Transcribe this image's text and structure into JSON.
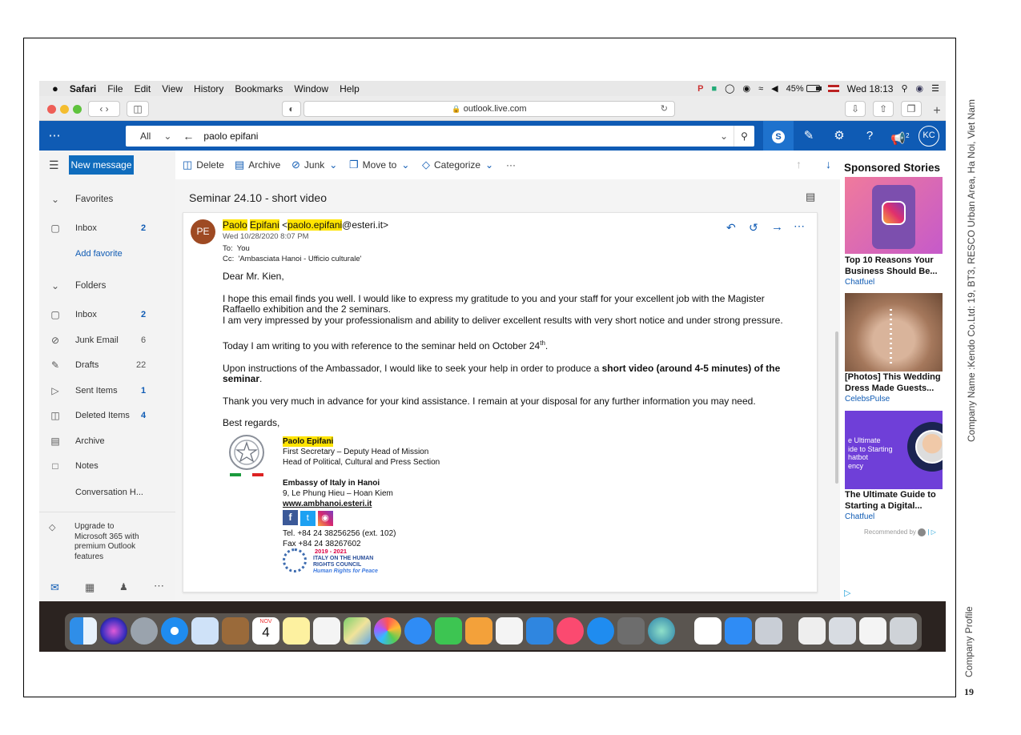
{
  "page": {
    "side_company": "Company Name  :Kendo Co.Ltd:  19, BT3, RESCO Urban Area, Ha Noi, Viet Nam",
    "side_profile": "Company Profile",
    "page_number": "19"
  },
  "mac_menu": {
    "app": "Safari",
    "items": [
      "File",
      "Edit",
      "View",
      "History",
      "Bookmarks",
      "Window",
      "Help"
    ],
    "battery": "45%",
    "clock": "Wed 18:13"
  },
  "browser": {
    "url": "outlook.live.com"
  },
  "outlook_top": {
    "scope": "All",
    "search_value": "paolo epifani",
    "avatar_initials": "KC",
    "badge": "2"
  },
  "nav": {
    "new_message": "New message",
    "favorites": "Favorites",
    "fav_items": [
      {
        "label": "Inbox",
        "count": "2"
      },
      {
        "label": "Add favorite",
        "count": ""
      }
    ],
    "folders": "Folders",
    "folder_items": [
      {
        "label": "Inbox",
        "count": "2"
      },
      {
        "label": "Junk Email",
        "count": "6"
      },
      {
        "label": "Drafts",
        "count": "22"
      },
      {
        "label": "Sent Items",
        "count": "1"
      },
      {
        "label": "Deleted Items",
        "count": "4"
      },
      {
        "label": "Archive",
        "count": ""
      },
      {
        "label": "Notes",
        "count": ""
      },
      {
        "label": "Conversation H...",
        "count": ""
      }
    ],
    "upgrade": [
      "Upgrade to",
      "Microsoft 365 with",
      "premium Outlook",
      "features"
    ]
  },
  "toolbar": {
    "delete": "Delete",
    "archive": "Archive",
    "junk": "Junk",
    "move_to": "Move to",
    "categorize": "Categorize",
    "more": "···"
  },
  "email": {
    "subject": "Seminar 24.10 - short video",
    "avatar": "PE",
    "sender_first": "Paolo",
    "sender_last": "Epifani",
    "email_open": "<",
    "email_hl": "paolo.epifani",
    "email_rest": "@esteri.it>",
    "date": "Wed 10/28/2020 8:07 PM",
    "to_label": "To:",
    "to_value": "You",
    "cc_label": "Cc:",
    "cc_value": "'Ambasciata Hanoi - Ufficio culturale'",
    "greeting": "Dear Mr. Kien,",
    "p1": "I hope this email finds you well. I would like to express my gratitude to you and your staff for your excellent job with the Magister Raffaello exhibition and the 2 seminars.",
    "p1b": "I am very impressed by your professionalism and ability to deliver excellent results with very short notice and under strong pressure.",
    "p2": "Today I am writing to you with reference to the seminar held on October 24",
    "p2_sup": "th",
    "p2_end": ".",
    "p3_a": "Upon instructions of the Ambassador, I would like to seek your help in order to produce a ",
    "p3_bold": "short video (around 4-5 minutes) of the seminar",
    "p3_end": ".",
    "p4": "Thank you very much in advance for your kind assistance. I remain at your disposal for any further information you may need.",
    "closing": "Best regards,",
    "sig_name": "Paolo Epifani",
    "sig_title1": "First Secretary – Deputy Head of Mission",
    "sig_title2": "Head of Political, Cultural and Press Section",
    "sig_org": "Embassy of Italy in Hanoi",
    "sig_addr": "9, Le Phung Hieu – Hoan Kiem",
    "sig_web": "www.ambhanoi.esteri.it",
    "sig_tel": "Tel. +84 24 38256256 (ext. 102)",
    "sig_fax": "Fax +84 24 38267602",
    "hrc_years": "2019 - 2021",
    "hrc_line1": "ITALY ON THE HUMAN",
    "hrc_line2": "RIGHTS COUNCIL",
    "hrc_line3": "Human Rights for Peace"
  },
  "ads": {
    "heading": "Sponsored Stories",
    "items": [
      {
        "title": "Top 10 Reasons Your Business Should Be...",
        "source": "Chatfuel"
      },
      {
        "title": "[Photos] This Wedding Dress Made Guests...",
        "source": "CelebsPulse"
      },
      {
        "title": "The Ultimate Guide to Starting a Digital...",
        "source": "Chatfuel"
      }
    ],
    "ad3_image_text": [
      "e Ultimate",
      "ide to Starting",
      "hatbot",
      "ency"
    ],
    "recommended": "Recommended by"
  },
  "dock": {
    "calendar_month": "NOV",
    "calendar_day": "4"
  }
}
